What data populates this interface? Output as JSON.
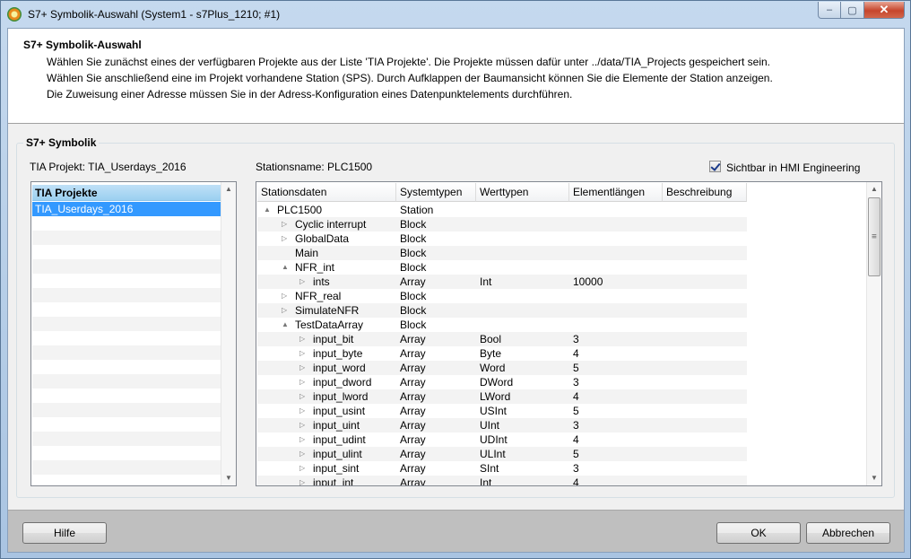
{
  "window": {
    "title": "S7+ Symbolik-Auswahl (System1 - s7Plus_1210; #1)",
    "close_glyph": "✕",
    "max_glyph": "▢",
    "min_glyph": "–"
  },
  "header": {
    "title": "S7+ Symbolik-Auswahl",
    "lines": [
      "Wählen Sie zunächst eines der verfügbaren Projekte aus der Liste 'TIA Projekte'. Die Projekte müssen dafür unter ../data/TIA_Projects gespeichert sein.",
      "Wählen Sie anschließend eine im Projekt vorhandene Station (SPS). Durch Aufklappen der Baumansicht können Sie die Elemente der Station anzeigen.",
      "Die Zuweisung einer Adresse müssen Sie in der Adress-Konfiguration eines Datenpunktelements durchführen."
    ]
  },
  "group": {
    "title": "S7+ Symbolik",
    "tia_project_label": "TIA Projekt: TIA_Userdays_2016",
    "station_label": "Stationsname: PLC1500",
    "hmi_checkbox_label": "Sichtbar in HMI Engineering",
    "hmi_checked": true
  },
  "project_list": {
    "header": "TIA Projekte",
    "items": [
      "TIA_Userdays_2016"
    ],
    "selected_index": 0
  },
  "tree": {
    "columns": [
      "Stationsdaten",
      "Systemtypen",
      "Werttypen",
      "Elementlängen",
      "Beschreibung"
    ],
    "rows": [
      {
        "name": "PLC1500",
        "level": 0,
        "toggle": "▲",
        "system": "Station",
        "value": "",
        "length": "",
        "desc": ""
      },
      {
        "name": "Cyclic interrupt",
        "level": 1,
        "toggle": "▷",
        "system": "Block",
        "value": "",
        "length": "",
        "desc": ""
      },
      {
        "name": "GlobalData",
        "level": 1,
        "toggle": "▷",
        "system": "Block",
        "value": "",
        "length": "",
        "desc": ""
      },
      {
        "name": "Main",
        "level": 1,
        "toggle": "",
        "system": "Block",
        "value": "",
        "length": "",
        "desc": ""
      },
      {
        "name": "NFR_int",
        "level": 1,
        "toggle": "▲",
        "system": "Block",
        "value": "",
        "length": "",
        "desc": ""
      },
      {
        "name": "ints",
        "level": 2,
        "toggle": "▷",
        "system": "Array",
        "value": "Int",
        "length": "10000",
        "desc": ""
      },
      {
        "name": "NFR_real",
        "level": 1,
        "toggle": "▷",
        "system": "Block",
        "value": "",
        "length": "",
        "desc": ""
      },
      {
        "name": "SimulateNFR",
        "level": 1,
        "toggle": "▷",
        "system": "Block",
        "value": "",
        "length": "",
        "desc": ""
      },
      {
        "name": "TestDataArray",
        "level": 1,
        "toggle": "▲",
        "system": "Block",
        "value": "",
        "length": "",
        "desc": ""
      },
      {
        "name": "input_bit",
        "level": 2,
        "toggle": "▷",
        "system": "Array",
        "value": "Bool",
        "length": "3",
        "desc": ""
      },
      {
        "name": "input_byte",
        "level": 2,
        "toggle": "▷",
        "system": "Array",
        "value": "Byte",
        "length": "4",
        "desc": ""
      },
      {
        "name": "input_word",
        "level": 2,
        "toggle": "▷",
        "system": "Array",
        "value": "Word",
        "length": "5",
        "desc": ""
      },
      {
        "name": "input_dword",
        "level": 2,
        "toggle": "▷",
        "system": "Array",
        "value": "DWord",
        "length": "3",
        "desc": ""
      },
      {
        "name": "input_lword",
        "level": 2,
        "toggle": "▷",
        "system": "Array",
        "value": "LWord",
        "length": "4",
        "desc": ""
      },
      {
        "name": "input_usint",
        "level": 2,
        "toggle": "▷",
        "system": "Array",
        "value": "USInt",
        "length": "5",
        "desc": ""
      },
      {
        "name": "input_uint",
        "level": 2,
        "toggle": "▷",
        "system": "Array",
        "value": "UInt",
        "length": "3",
        "desc": ""
      },
      {
        "name": "input_udint",
        "level": 2,
        "toggle": "▷",
        "system": "Array",
        "value": "UDInt",
        "length": "4",
        "desc": ""
      },
      {
        "name": "input_ulint",
        "level": 2,
        "toggle": "▷",
        "system": "Array",
        "value": "ULInt",
        "length": "5",
        "desc": ""
      },
      {
        "name": "input_sint",
        "level": 2,
        "toggle": "▷",
        "system": "Array",
        "value": "SInt",
        "length": "3",
        "desc": ""
      },
      {
        "name": "input_int",
        "level": 2,
        "toggle": "▷",
        "system": "Array",
        "value": "Int",
        "length": "4",
        "desc": ""
      }
    ]
  },
  "footer": {
    "help_label": "Hilfe",
    "ok_label": "OK",
    "cancel_label": "Abbrechen"
  }
}
